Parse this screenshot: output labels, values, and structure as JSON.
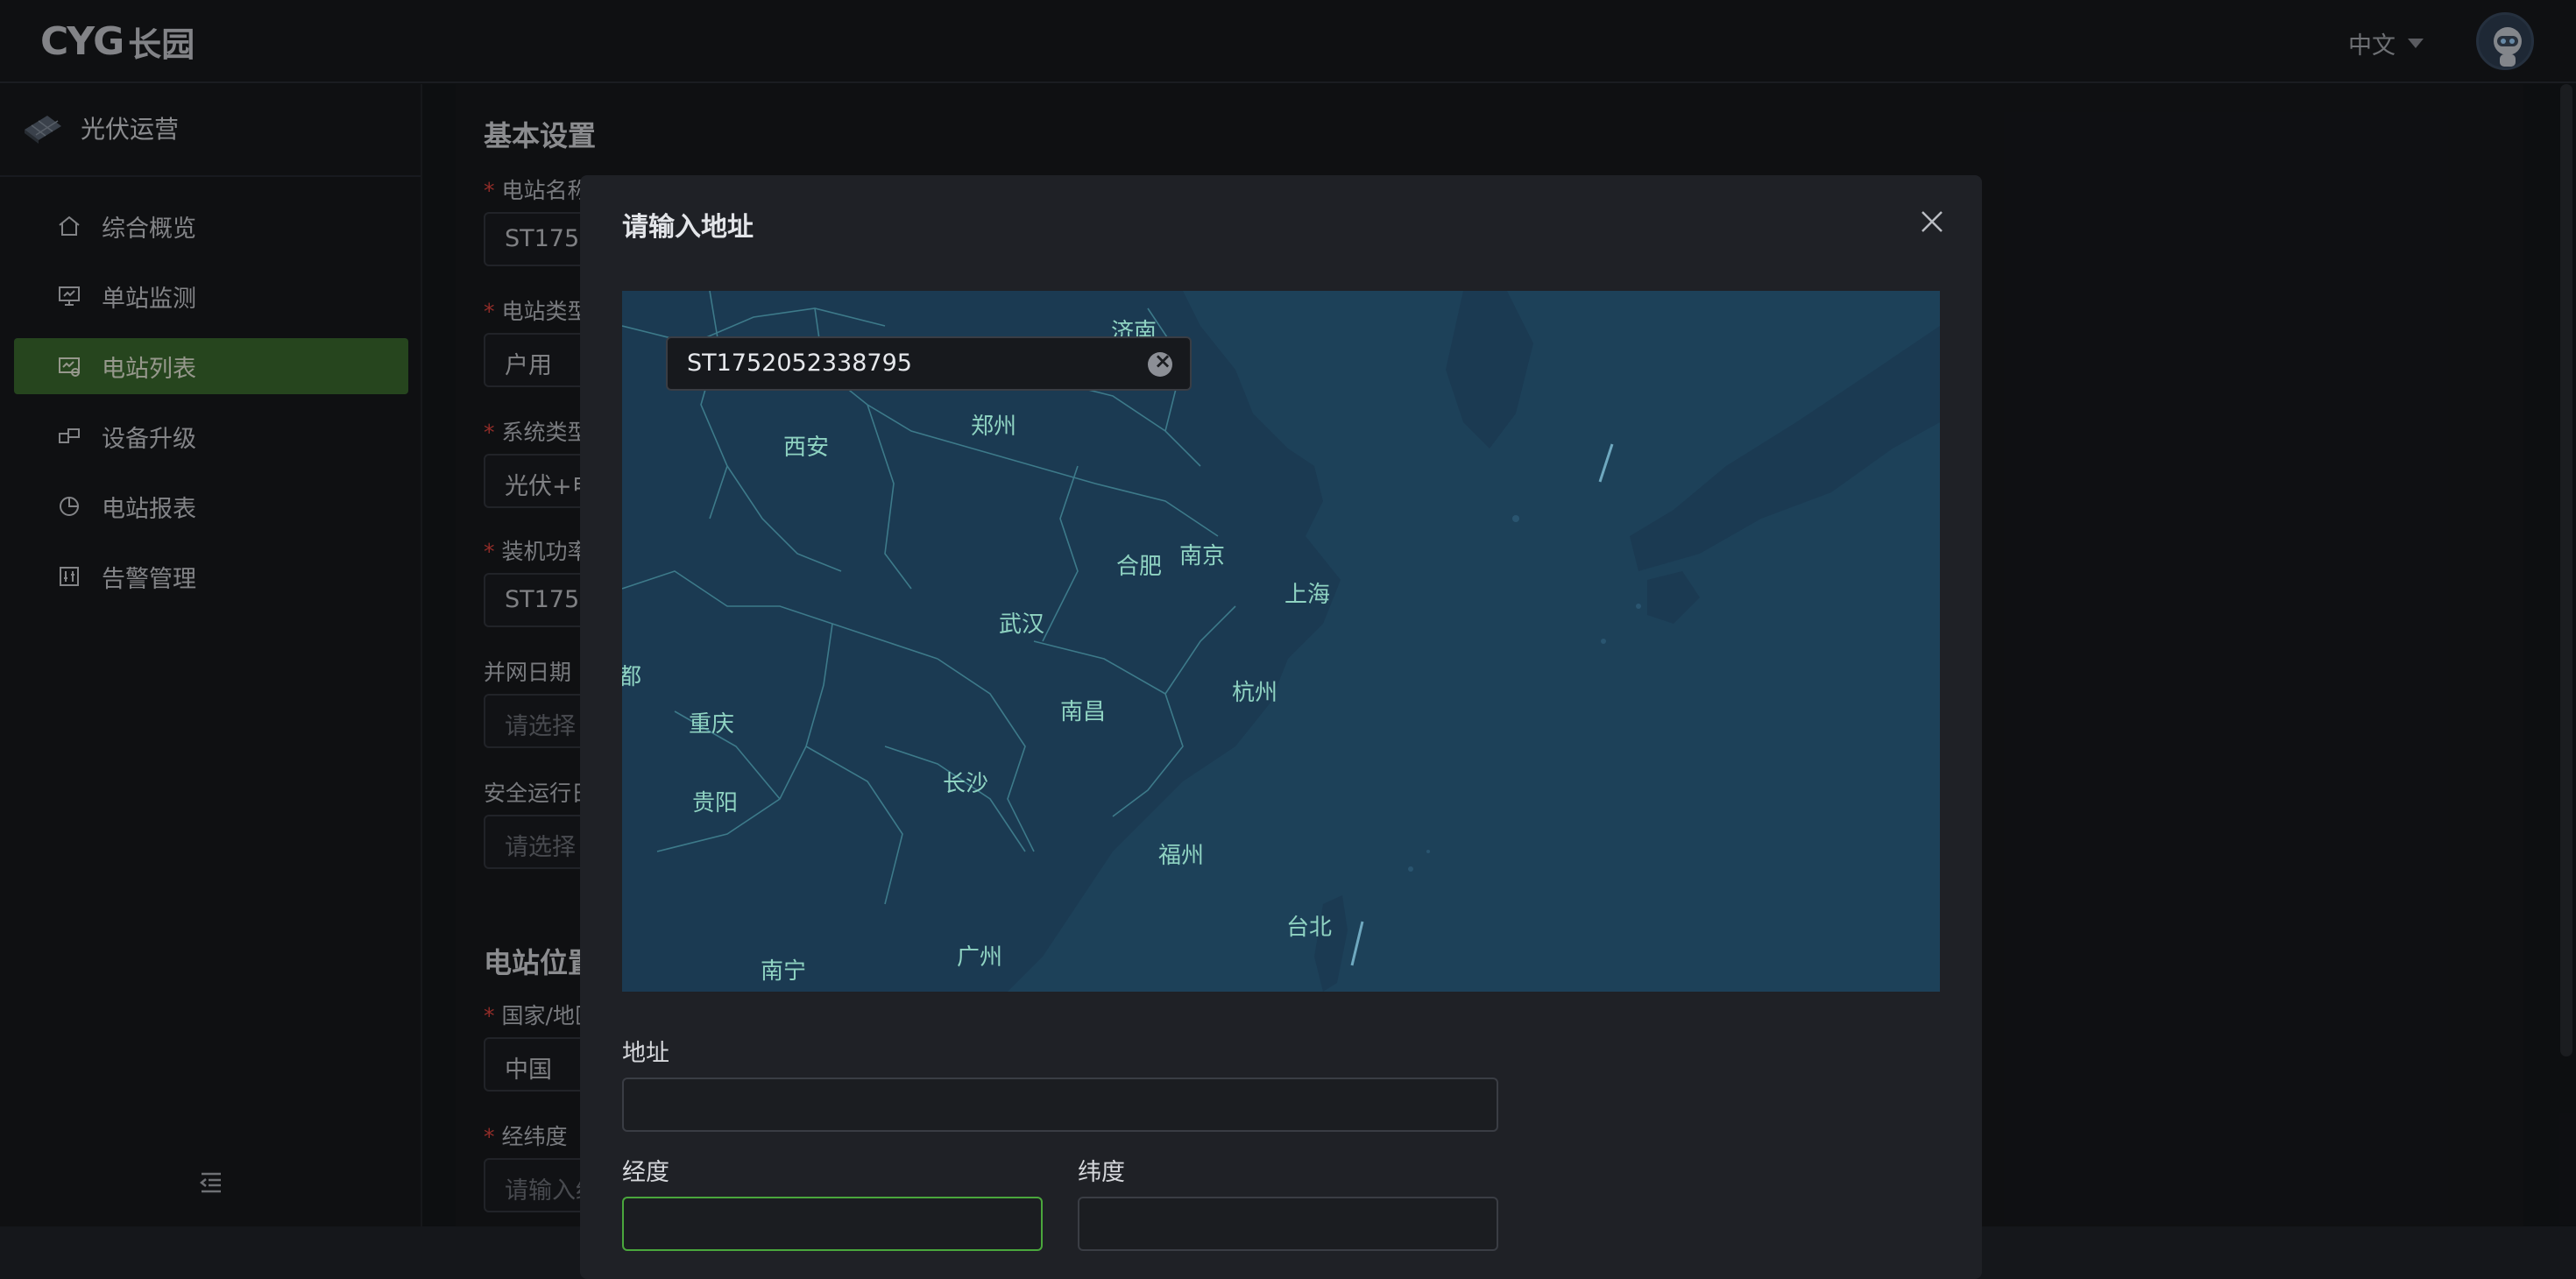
{
  "header": {
    "logo_mark": "CYG",
    "logo_cn": "长园",
    "language": "中文"
  },
  "sidebar": {
    "brand": "光伏运营",
    "items": [
      {
        "label": "综合概览",
        "icon": "home-icon"
      },
      {
        "label": "单站监测",
        "icon": "monitor-icon"
      },
      {
        "label": "电站列表",
        "icon": "station-list-icon",
        "active": true
      },
      {
        "label": "设备升级",
        "icon": "upgrade-icon"
      },
      {
        "label": "电站报表",
        "icon": "report-icon"
      },
      {
        "label": "告警管理",
        "icon": "alarm-icon"
      }
    ]
  },
  "page": {
    "basic_title": "基本设置",
    "fields": [
      {
        "label": "电站名称",
        "value": "ST175",
        "required": true
      },
      {
        "label": "电站类型",
        "value": "户用",
        "required": true
      },
      {
        "label": "系统类型",
        "value": "光伏+电",
        "required": true
      },
      {
        "label": "装机功率",
        "value": "ST175",
        "required": true
      },
      {
        "label": "并网日期",
        "value": "请选择",
        "required": false
      },
      {
        "label": "安全运行日",
        "value": "请选择",
        "required": false
      }
    ],
    "location_title": "电站位置",
    "location_fields": [
      {
        "label": "国家/地区",
        "value": "中国",
        "required": true
      },
      {
        "label": "经纬度",
        "value": "请输入经",
        "required": true
      }
    ]
  },
  "modal": {
    "title": "请输入地址",
    "search_value": "ST1752052338795",
    "address_label": "地址",
    "address_value": "",
    "longitude_label": "经度",
    "longitude_value": "",
    "latitude_label": "纬度",
    "latitude_value": ""
  },
  "map": {
    "cities": [
      "济南",
      "郑州",
      "西安",
      "合肥",
      "南京",
      "上海",
      "武汉",
      "都",
      "重庆",
      "南昌",
      "杭州",
      "长沙",
      "贵阳",
      "福州",
      "台北",
      "广州",
      "南宁"
    ]
  },
  "colors": {
    "accent": "#3b6b2e",
    "focus_border": "#4aa73c",
    "required": "#e0453e",
    "map_bg": "#1d4159",
    "city_label": "#8fd3c2"
  }
}
